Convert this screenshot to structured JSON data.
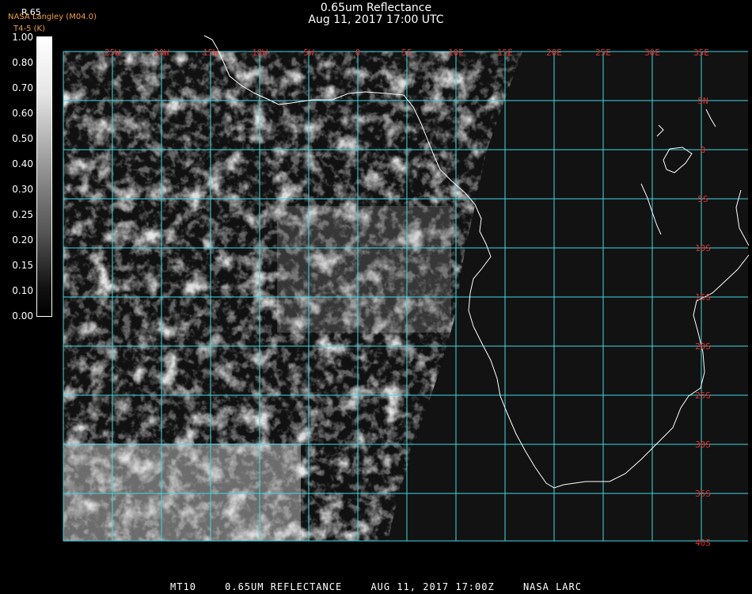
{
  "header": {
    "title": "0.65um Reflectance",
    "datetime": "Aug 11, 2017 17:00 UTC",
    "producer": "NASA Langley (M04.0)",
    "units": "T4-5 (K)",
    "scale_name": "R.65"
  },
  "colorbar": {
    "labels": [
      "1.00",
      "0.80",
      "0.70",
      "0.60",
      "0.50",
      "0.40",
      "0.30",
      "0.25",
      "0.20",
      "0.15",
      "0.10",
      "0.00"
    ]
  },
  "map": {
    "lon_labels": [
      "25W",
      "20W",
      "15W",
      "10W",
      "5W",
      "0",
      "5E",
      "10E",
      "15E",
      "20E",
      "25E",
      "30E",
      "35E"
    ],
    "lat_labels": [
      "5N",
      "0",
      "5S",
      "10S",
      "15S",
      "20S",
      "25S",
      "30S",
      "35S",
      "40S"
    ],
    "grid_color": "#40d8e0",
    "label_color": "#e03030",
    "coast_color": "#ffffff"
  },
  "footer": {
    "sat": "MT10",
    "product": "0.65UM REFLECTANCE",
    "date": "AUG 11, 2017 17:00Z",
    "org": "NASA LARC"
  }
}
